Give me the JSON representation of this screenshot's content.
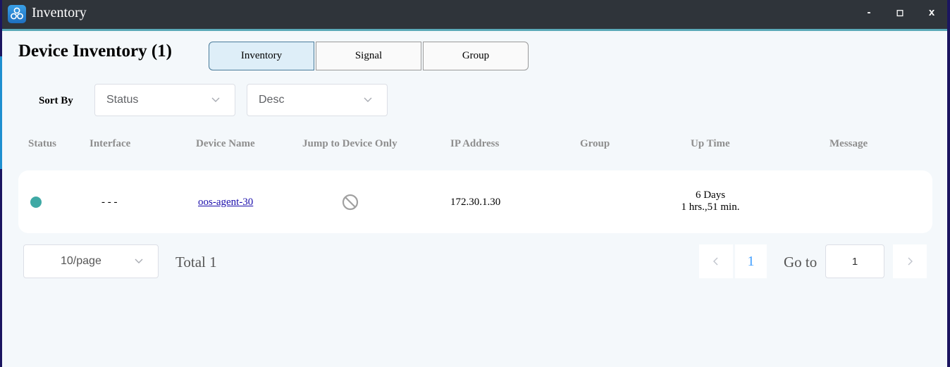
{
  "window": {
    "title": "Inventory",
    "controls": {
      "minimize": "-",
      "maximize": "◻",
      "close": "x"
    }
  },
  "page": {
    "title": "Device Inventory (1)"
  },
  "tabs": [
    {
      "label": "Inventory",
      "active": true
    },
    {
      "label": "Signal",
      "active": false
    },
    {
      "label": "Group",
      "active": false
    }
  ],
  "sort": {
    "label": "Sort By",
    "field": "Status",
    "order": "Desc"
  },
  "table": {
    "headers": [
      "Status",
      "Interface",
      "Device Name",
      "Jump to Device Only",
      "IP Address",
      "Group",
      "Up Time",
      "Message"
    ],
    "rows": [
      {
        "status_color": "#3fa9a5",
        "interface": "- - -",
        "device_name": "oos-agent-30",
        "jump_icon": "prohibited-icon",
        "ip_address": "172.30.1.30",
        "group": "",
        "uptime_line1": "6 Days",
        "uptime_line2": "1 hrs.,51 min.",
        "message": ""
      }
    ]
  },
  "pagination": {
    "page_size": "10/page",
    "total": "Total 1",
    "current_page": "1",
    "goto_label": "Go to",
    "goto_value": "1"
  },
  "colors": {
    "accent": "#409eff",
    "status_online": "#3fa9a5",
    "titlebar": "#2f343a"
  }
}
